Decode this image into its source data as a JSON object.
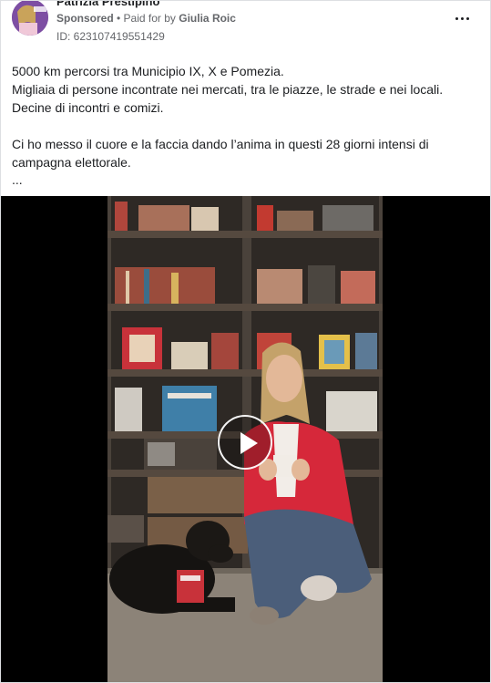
{
  "ad": {
    "advertiser_name": "Patrizia Prestipino",
    "sponsored_label": "Sponsored",
    "paid_for_prefix": "• Paid for by",
    "paid_for_name": "Giulia Roic",
    "ad_id": "ID: 623107419551429",
    "body_paragraphs": [
      "5000 km percorsi tra Municipio IX, X e Pomezia.",
      "Migliaia di persone incontrate nei mercati, tra le piazze, le strade e nei locali.",
      "Decine di incontri e comizi.",
      "",
      "Ci ho messo il cuore e la faccia dando l’anima in questi 28 giorni intensi di",
      "campagna elettorale."
    ],
    "truncation": "..."
  },
  "icons": {
    "more": "more-horizontal-icon",
    "play": "play-icon"
  },
  "colors": {
    "secondary_text": "#65676b",
    "primary_text": "#1c1e21",
    "border": "#dddfe2",
    "video_bg": "#000000",
    "jacket": "#d6283a"
  }
}
